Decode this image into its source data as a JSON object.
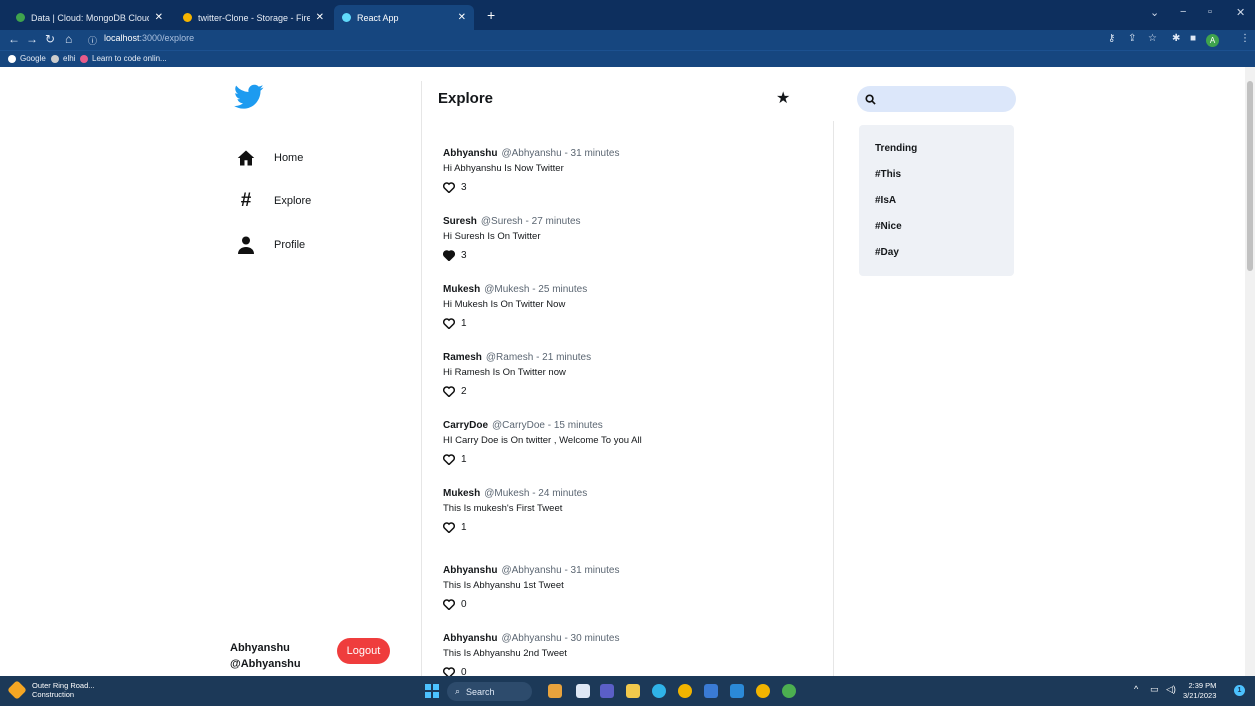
{
  "browser": {
    "tabs": [
      {
        "label": "Data | Cloud: MongoDB Cloud",
        "color": "#3fa34d",
        "active": false
      },
      {
        "label": "twitter-Clone - Storage - Firebas",
        "color": "#f5b400",
        "active": false
      },
      {
        "label": "React App",
        "color": "#61dafb",
        "active": true
      }
    ],
    "url_host": "localhost",
    "url_rest": ":3000/explore",
    "profile_initial": "A",
    "bookmarks": [
      {
        "label": "Google",
        "color": "#ffffff"
      },
      {
        "label": "elhi",
        "color": "#cccccc"
      },
      {
        "label": "Learn to code onlin...",
        "color": "#e85b8a"
      }
    ]
  },
  "sidebar": {
    "nav": [
      {
        "label": "Home",
        "icon": "home-icon"
      },
      {
        "label": "Explore",
        "icon": "hashtag-icon"
      },
      {
        "label": "Profile",
        "icon": "person-icon"
      }
    ],
    "user_name": "Abhyanshu",
    "user_handle": "@Abhyanshu",
    "logout_label": "Logout"
  },
  "feed": {
    "title": "Explore",
    "tweets": [
      {
        "name": "Abhyanshu",
        "handle": "@Abhyanshu",
        "time": "- 31 minutes",
        "text": "Hi Abhyanshu Is Now Twitter",
        "likes": "3",
        "liked": false
      },
      {
        "name": "Suresh",
        "handle": "@Suresh",
        "time": "- 27 minutes",
        "text": "Hi Suresh Is On Twitter",
        "likes": "3",
        "liked": true
      },
      {
        "name": "Mukesh",
        "handle": "@Mukesh",
        "time": "- 25 minutes",
        "text": "Hi Mukesh Is On Twitter Now",
        "likes": "1",
        "liked": false
      },
      {
        "name": "Ramesh",
        "handle": "@Ramesh",
        "time": "- 21 minutes",
        "text": "Hi Ramesh Is On Twitter now",
        "likes": "2",
        "liked": false
      },
      {
        "name": "CarryDoe",
        "handle": "@CarryDoe",
        "time": "- 15 minutes",
        "text": "HI Carry Doe is On twitter , Welcome To you All",
        "likes": "1",
        "liked": false
      },
      {
        "name": "Mukesh",
        "handle": "@Mukesh",
        "time": "- 24 minutes",
        "text": "This Is mukesh's First Tweet",
        "likes": "1",
        "liked": false
      },
      {
        "name": "Abhyanshu",
        "handle": "@Abhyanshu",
        "time": "- 31 minutes",
        "text": "This Is Abhyanshu 1st Tweet",
        "likes": "0",
        "liked": false
      },
      {
        "name": "Abhyanshu",
        "handle": "@Abhyanshu",
        "time": "- 30 minutes",
        "text": "This Is Abhyanshu 2nd Tweet",
        "likes": "0",
        "liked": false
      }
    ]
  },
  "search": {
    "placeholder": ""
  },
  "trending": {
    "title": "Trending",
    "items": [
      "#This",
      "#IsA",
      "#Nice",
      "#Day"
    ]
  },
  "taskbar": {
    "weather_line1": "Outer Ring Road...",
    "weather_line2": "Construction",
    "search_label": "Search",
    "time": "2:39 PM",
    "date": "3/21/2023",
    "notifications": "1"
  },
  "colors": {
    "accent": "#1d9bf0",
    "logout": "#ef3d3d",
    "search_bg": "#dce7fa",
    "trend_bg": "#eef1f6"
  }
}
